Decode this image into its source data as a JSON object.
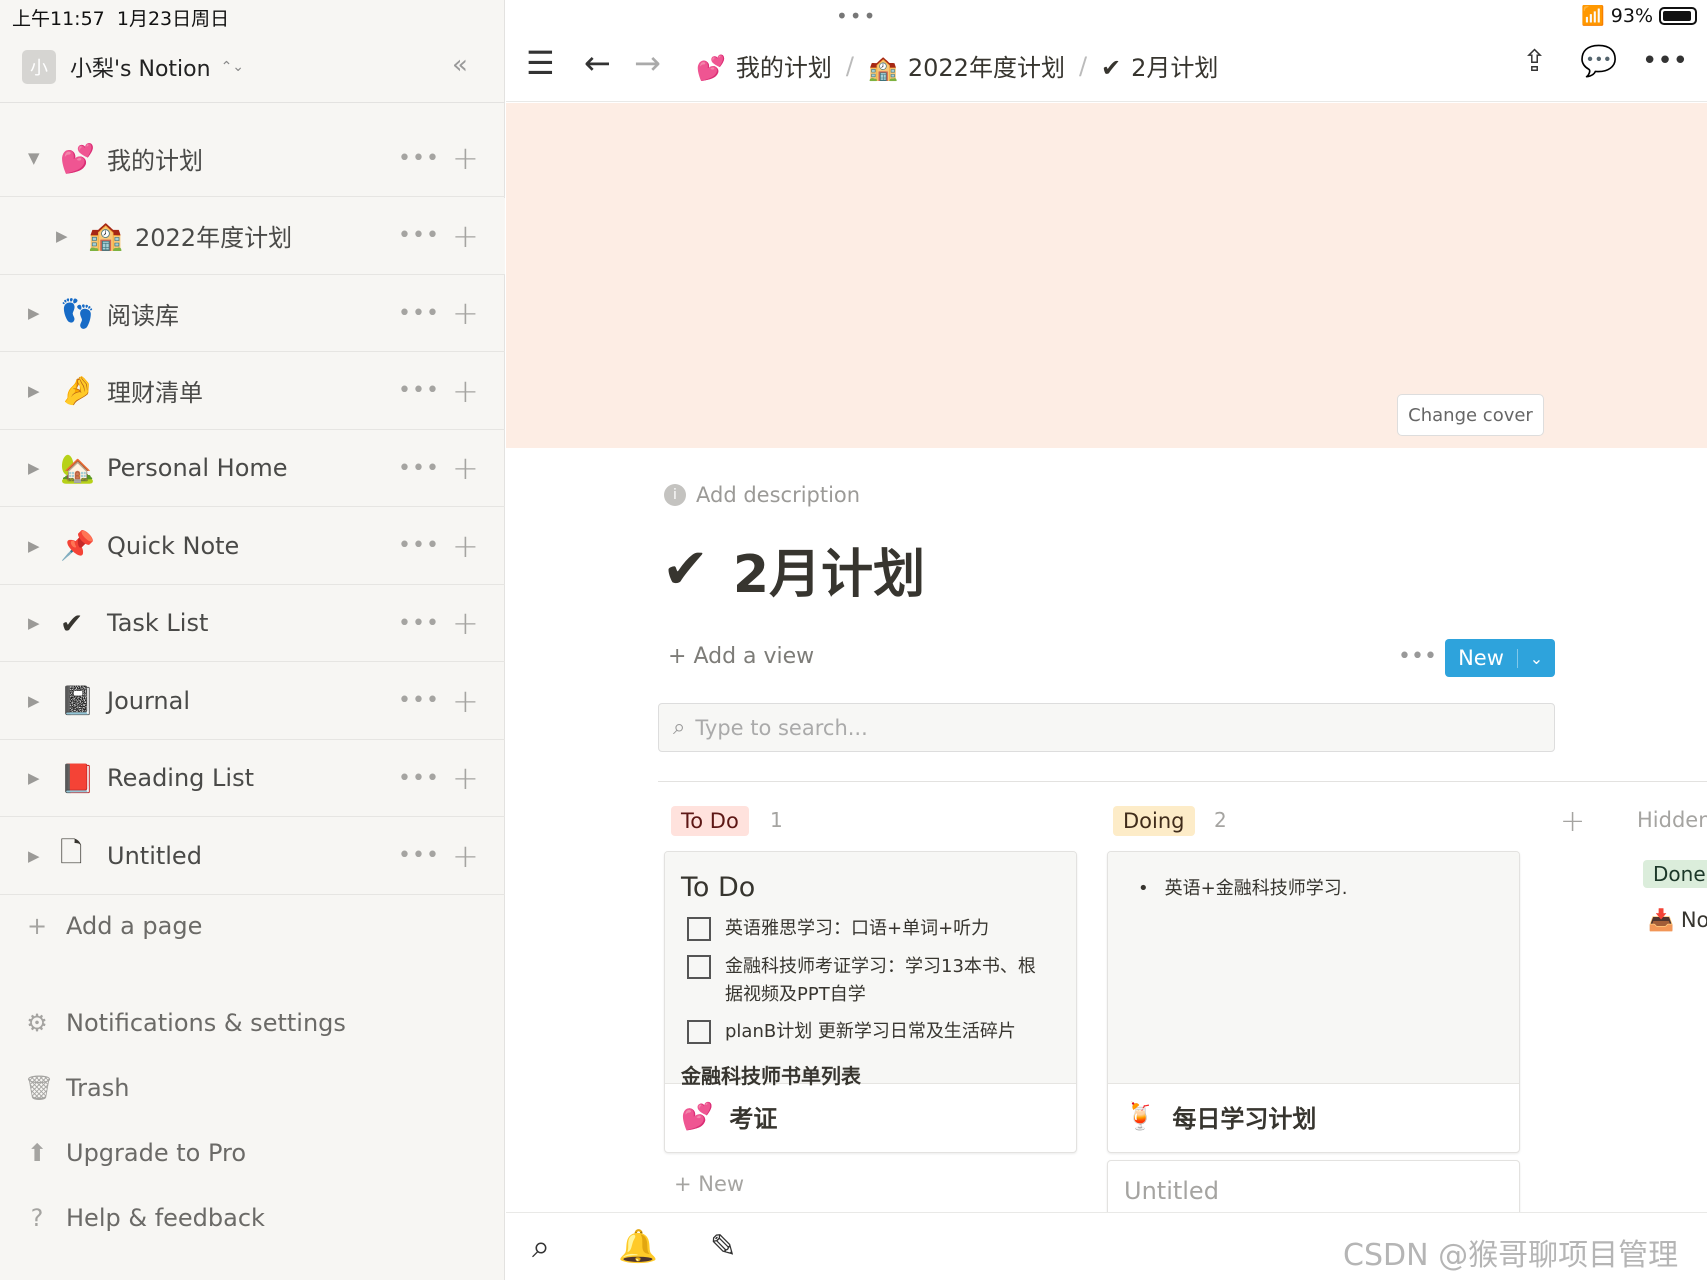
{
  "status": {
    "time": "上午11:57",
    "date": "1月23日周日",
    "battery": "93%"
  },
  "workspace": {
    "avatar": "小",
    "name": "小梨's Notion"
  },
  "sidebar": {
    "items": [
      {
        "emoji": "💕",
        "label": "我的计划",
        "expanded": true
      },
      {
        "emoji": "🏫",
        "label": "2022年度计划",
        "child": true
      },
      {
        "emoji": "👣",
        "label": "阅读库"
      },
      {
        "emoji": "🤌",
        "label": "理财清单"
      },
      {
        "emoji": "🏡",
        "label": "Personal Home"
      },
      {
        "emoji": "📌",
        "label": "Quick Note"
      },
      {
        "emoji": "✔",
        "label": "Task List"
      },
      {
        "emoji": "📓",
        "label": "Journal"
      },
      {
        "emoji": "📕",
        "label": "Reading List"
      },
      {
        "emoji": "🗋",
        "label": "Untitled"
      }
    ],
    "add_page": "Add a page",
    "footer": {
      "notifications": "Notifications & settings",
      "trash": "Trash",
      "upgrade": "Upgrade to Pro",
      "help": "Help & feedback"
    }
  },
  "breadcrumb": [
    {
      "emoji": "💕",
      "label": "我的计划"
    },
    {
      "emoji": "🏫",
      "label": "2022年度计划"
    },
    {
      "emoji": "✔",
      "label": "2月计划"
    }
  ],
  "cover": {
    "change_label": "Change cover",
    "color": "#fdede4"
  },
  "page": {
    "add_description": "Add description",
    "icon": "✔",
    "title": "2月计划",
    "add_view": "Add a view",
    "new_label": "New",
    "search_placeholder": "Type to search..."
  },
  "board": {
    "columns": [
      {
        "name": "To Do",
        "count": "1",
        "bg": "#ffe2dd",
        "color": "#5d1715"
      },
      {
        "name": "Doing",
        "count": "2",
        "bg": "#fdecc8",
        "color": "#402c1b"
      }
    ],
    "hidden_label": "Hidden",
    "hidden_done": "Done",
    "hidden_no": "No",
    "todo_card": {
      "heading": "To Do",
      "items": [
        "英语雅思学习：口语+单词+听力",
        "金融科技师考证学习：学习13本书、根",
        "据视频及PPT自学",
        "planB计划 更新学习日常及生活碎片"
      ],
      "subheading": "金融科技师书单列表",
      "emoji": "💕",
      "title": "考证"
    },
    "doing_card1": {
      "bullet": "英语+金融科技师学习.",
      "emoji": "🍹",
      "title": "每日学习计划"
    },
    "doing_card2": {
      "title": "Untitled"
    },
    "new_label": "New"
  },
  "watermark": "CSDN @猴哥聊项目管理"
}
